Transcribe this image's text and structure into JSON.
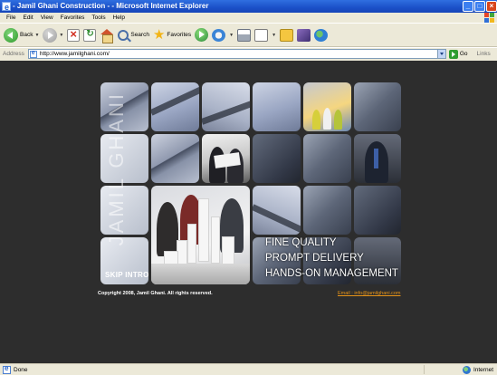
{
  "window": {
    "title": " - Jamil Ghani Construction - - Microsoft Internet Explorer"
  },
  "menu": [
    "File",
    "Edit",
    "View",
    "Favorites",
    "Tools",
    "Help"
  ],
  "toolbar": {
    "back_label": "Back",
    "search_label": "Search",
    "favorites_label": "Favorites"
  },
  "address": {
    "label": "Address",
    "url": "http://www.jamilghani.com/",
    "go_label": "Go",
    "links_label": "Links"
  },
  "site": {
    "brand": "JAMIL GHANI",
    "taglines": [
      "FINE QUALITY",
      "PROMPT DELIVERY",
      "HANDS-ON MANAGEMENT"
    ],
    "skip_intro": "SKIP INTRO",
    "copyright": "Copyright 2008, Jamil Ghani. All rights reserved.",
    "email": "Email : info@jamilghani.com"
  },
  "status": {
    "text": "Done",
    "zone": "Internet"
  },
  "colors": {
    "page_bg": "#2d2d2d",
    "email_link": "#e69317",
    "title_bar": "#1b50c8"
  }
}
